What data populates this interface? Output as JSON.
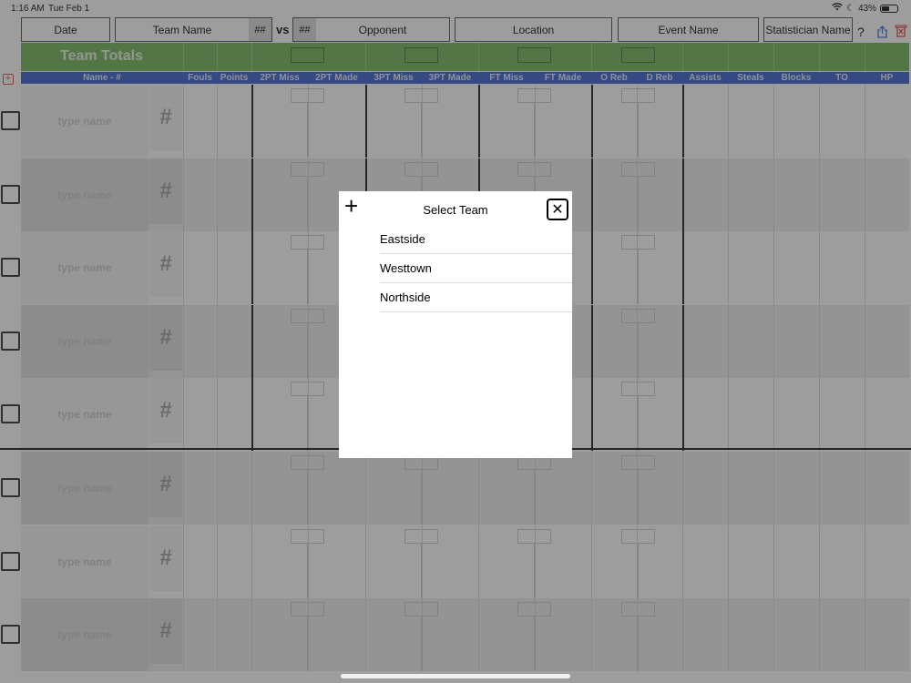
{
  "status": {
    "time": "1:16 AM",
    "date": "Tue Feb 1",
    "battery": "43%"
  },
  "header": {
    "date": "Date",
    "team_name": "Team Name",
    "team_num": "##",
    "vs": "vs",
    "opp_num": "##",
    "opponent": "Opponent",
    "location": "Location",
    "event": "Event Name",
    "statistician": "Statistician Name",
    "help": "?"
  },
  "totals_label": "Team Totals",
  "columns": {
    "name": "Name - #",
    "fouls": "Fouls",
    "points": "Points",
    "p2miss": "2PT Miss",
    "p2made": "2PT Made",
    "p3miss": "3PT Miss",
    "p3made": "3PT Made",
    "ftmiss": "FT Miss",
    "ftmade": "FT Made",
    "oreb": "O Reb",
    "dreb": "D Reb",
    "assists": "Assists",
    "steals": "Steals",
    "blocks": "Blocks",
    "to": "TO",
    "hp": "HP"
  },
  "rows": [
    {
      "name_placeholder": "type name",
      "number": "#"
    },
    {
      "name_placeholder": "type name",
      "number": "#"
    },
    {
      "name_placeholder": "type name",
      "number": "#"
    },
    {
      "name_placeholder": "type name",
      "number": "#"
    },
    {
      "name_placeholder": "type name",
      "number": "#"
    },
    {
      "name_placeholder": "type name",
      "number": "#"
    },
    {
      "name_placeholder": "type name",
      "number": "#"
    },
    {
      "name_placeholder": "type name",
      "number": "#"
    }
  ],
  "modal": {
    "title": "Select Team",
    "add": "+",
    "close": "✕",
    "teams": [
      "Eastside",
      "Westtown",
      "Northside"
    ]
  },
  "icons": {
    "share": "share-icon",
    "trash": "trash-icon",
    "add_player": "plus-square-icon"
  },
  "colors": {
    "totals_green": "#69b14f",
    "header_blue": "#2f56c9",
    "accent_red": "#d44444"
  }
}
